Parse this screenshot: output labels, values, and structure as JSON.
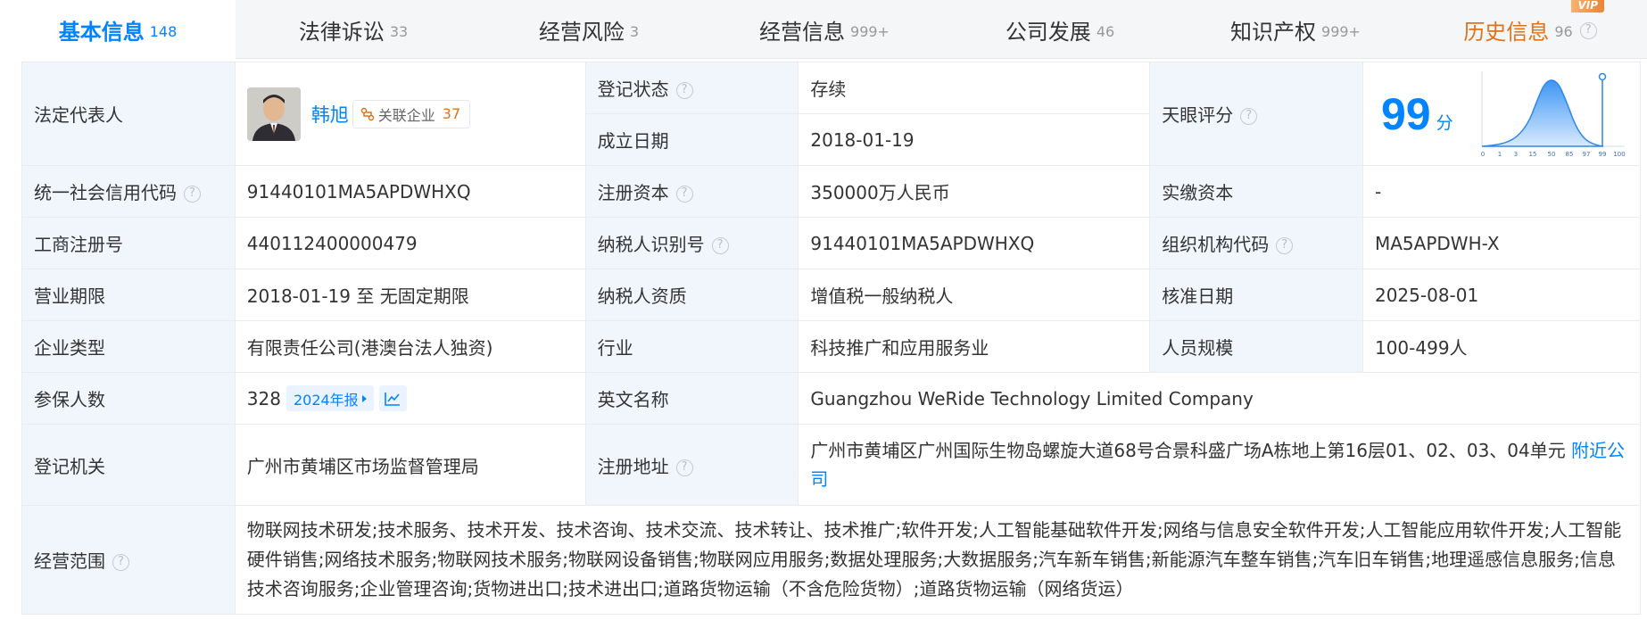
{
  "tabs": [
    {
      "label": "基本信息",
      "count": "148"
    },
    {
      "label": "法律诉讼",
      "count": "33"
    },
    {
      "label": "经营风险",
      "count": "3"
    },
    {
      "label": "经营信息",
      "count": "999+"
    },
    {
      "label": "公司发展",
      "count": "46"
    },
    {
      "label": "知识产权",
      "count": "999+"
    },
    {
      "label": "历史信息",
      "count": "96",
      "badge": "VIP"
    }
  ],
  "rows": {
    "legal_rep_label": "法定代表人",
    "legal_rep_name": "韩旭",
    "related_label": "关联企业",
    "related_count": "37",
    "reg_status_label": "登记状态",
    "reg_status_value": "存续",
    "founded_label": "成立日期",
    "founded_value": "2018-01-19",
    "score_label": "天眼评分",
    "score_value": "99",
    "score_unit": "分",
    "score_axis": [
      "0",
      "1",
      "3",
      "15",
      "50",
      "85",
      "97",
      "99",
      "100"
    ],
    "credit_code_label": "统一社会信用代码",
    "credit_code_value": "91440101MA5APDWHXQ",
    "reg_capital_label": "注册资本",
    "reg_capital_value": "350000万人民币",
    "paid_capital_label": "实缴资本",
    "paid_capital_value": "-",
    "biz_reg_no_label": "工商注册号",
    "biz_reg_no_value": "440112400000479",
    "taxpayer_id_label": "纳税人识别号",
    "taxpayer_id_value": "91440101MA5APDWHXQ",
    "org_code_label": "组织机构代码",
    "org_code_value": "MA5APDWH-X",
    "term_label": "营业期限",
    "term_value": "2018-01-19 至 无固定期限",
    "taxpayer_qual_label": "纳税人资质",
    "taxpayer_qual_value": "增值税一般纳税人",
    "approval_date_label": "核准日期",
    "approval_date_value": "2025-08-01",
    "company_type_label": "企业类型",
    "company_type_value": "有限责任公司(港澳台法人独资)",
    "industry_label": "行业",
    "industry_value": "科技推广和应用服务业",
    "staff_size_label": "人员规模",
    "staff_size_value": "100-499人",
    "insured_label": "参保人数",
    "insured_value": "328",
    "insured_report": "2024年报",
    "english_name_label": "英文名称",
    "english_name_value": "Guangzhou WeRide Technology Limited Company",
    "authority_label": "登记机关",
    "authority_value": "广州市黄埔区市场监督管理局",
    "address_label": "注册地址",
    "address_value": "广州市黄埔区广州国际生物岛螺旋大道68号合景科盛广场A栋地上第16层01、02、03、04单元",
    "address_link": "附近公司",
    "scope_label": "经营范围",
    "scope_value": "物联网技术研发;技术服务、技术开发、技术咨询、技术交流、技术转让、技术推广;软件开发;人工智能基础软件开发;网络与信息安全软件开发;人工智能应用软件开发;人工智能硬件销售;网络技术服务;物联网技术服务;物联网设备销售;物联网应用服务;数据处理服务;大数据服务;汽车新车销售;新能源汽车整车销售;汽车旧车销售;地理遥感信息服务;信息技术咨询服务;企业管理咨询;货物进出口;技术进出口;道路货物运输（不含危险货物）;道路货物运输（网络货运）"
  },
  "help_glyph": "?",
  "colors": {
    "accent": "#0084ff",
    "history": "#e0721a",
    "status_green": "#26a55a",
    "label_bg": "#f1f6fd"
  }
}
